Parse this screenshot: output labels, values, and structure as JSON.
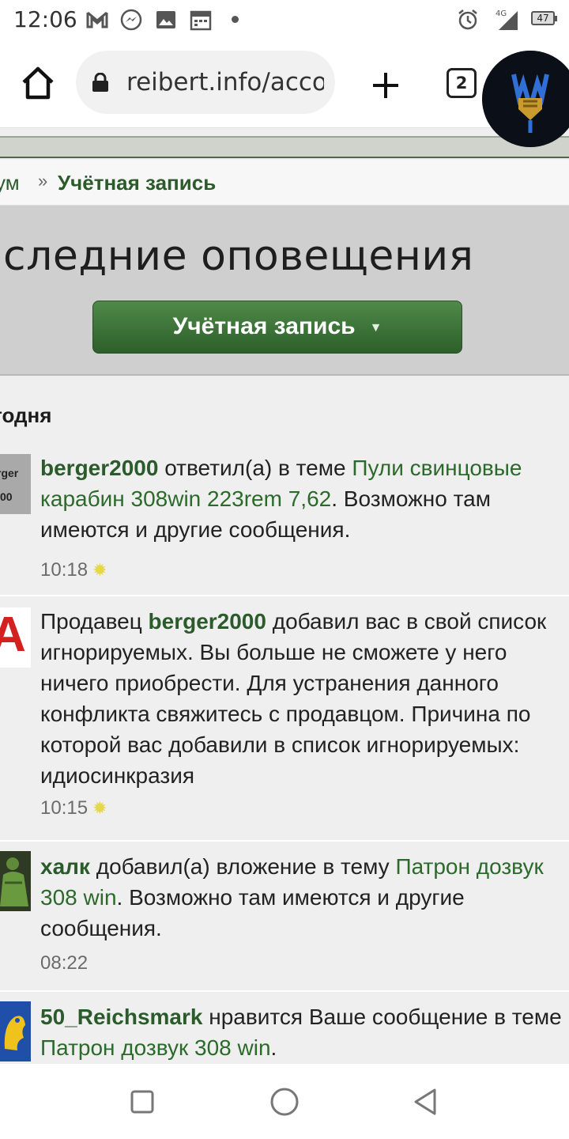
{
  "status_bar": {
    "time": "12:06",
    "battery": "47",
    "icons": [
      "gmail-icon",
      "messenger-icon",
      "gallery-icon",
      "calendar-icon",
      "alarm-icon",
      "signal-4g-icon",
      "battery-icon"
    ]
  },
  "browser": {
    "url": "reibert.info/account/alerts",
    "tab_count": "2"
  },
  "breadcrumb": {
    "forum": "ум",
    "separator": "»",
    "current": "Учётная запись"
  },
  "header": {
    "title": "следние оповещения",
    "account_button": "Учётная запись"
  },
  "section": {
    "label": "годня"
  },
  "notifications": [
    {
      "user": "berger2000",
      "text_before_link": " ответил(а) в теме ",
      "link": "Пули свинцовые карабин 308win 223rem 7,62",
      "text_after": ". Возможно там имеются и другие сообщения.",
      "time": "10:18",
      "avatar_text": [
        "rger",
        "00"
      ]
    },
    {
      "prefix": "Продавец ",
      "user": "berger2000",
      "text": " добавил вас в свой список игнорируемых. Вы больше не сможете у него ничего приобрести. Для устранения данного конфликта свяжитесь с продавцом. Причина по которой вас добавили в список игнорируемых: идиосинкразия",
      "time": "10:15",
      "avatar_text": "A"
    },
    {
      "user": "халк",
      "text_before_link": " добавил(а) вложение в тему ",
      "link": "Патрон дозвук 308 win",
      "text_after": ". Возможно там имеются и другие сообщения.",
      "time": "08:22"
    },
    {
      "user": "50_Reichsmark",
      "text_before_link": " нравится Ваше сообщение в теме ",
      "link": "Патрон дозвук 308 win",
      "text_after": "."
    }
  ],
  "colors": {
    "brand_green": "#2c5b2b",
    "button_green": "#3e7538",
    "link_green": "#2c6a2b",
    "page_bg": "#efefef",
    "header_bg": "#cfcfcf"
  }
}
